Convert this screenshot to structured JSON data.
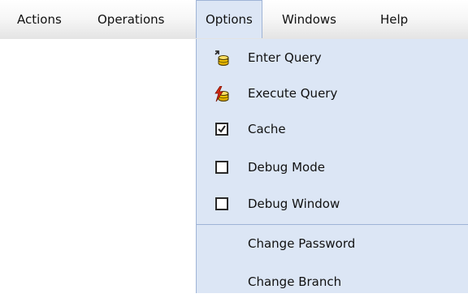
{
  "menubar": {
    "items": [
      {
        "label": "Actions"
      },
      {
        "label": "Operations"
      },
      {
        "label": "Options"
      },
      {
        "label": "Windows"
      },
      {
        "label": "Help"
      }
    ]
  },
  "dropdown": {
    "items": [
      {
        "label": "Enter Query",
        "icon": "enter-query-icon"
      },
      {
        "label": "Execute Query",
        "icon": "execute-query-icon"
      },
      {
        "label": "Cache",
        "checked": true
      },
      {
        "label": "Debug Mode",
        "checked": false
      },
      {
        "label": "Debug Window",
        "checked": false
      },
      {
        "label": "Change Password"
      },
      {
        "label": "Change Branch"
      }
    ]
  },
  "colors": {
    "menu_bg": "#dce6f5",
    "menu_border": "#9fb4d6",
    "db_yellow": "#f2c200",
    "lightning_red": "#d62a12"
  }
}
